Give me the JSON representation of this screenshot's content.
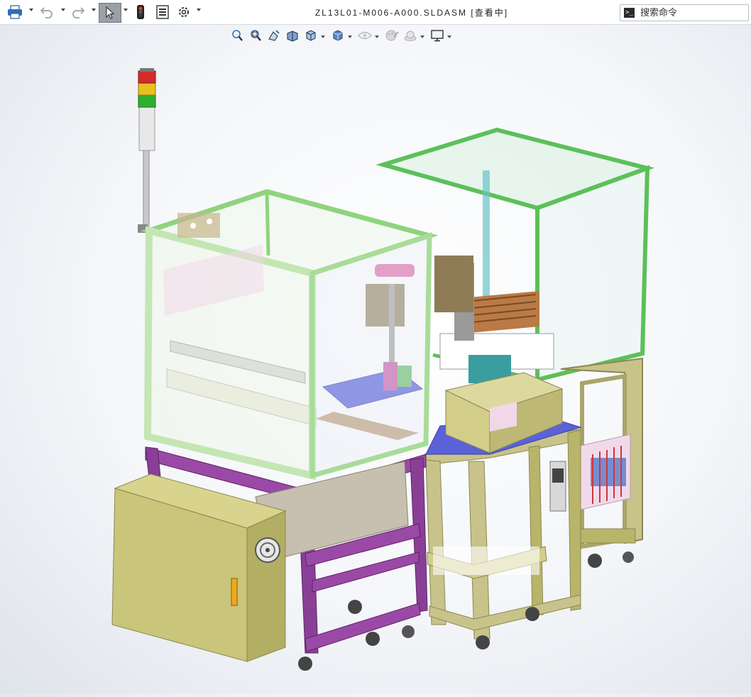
{
  "window": {
    "title": "ZL13L01-M006-A000.SLDASM [查看中]"
  },
  "toolbar": {
    "items": [
      {
        "name": "print",
        "icon": "printer-icon"
      },
      {
        "name": "undo",
        "icon": "undo-icon"
      },
      {
        "name": "redo",
        "icon": "redo-icon"
      },
      {
        "name": "select",
        "icon": "cursor-icon"
      },
      {
        "name": "traffic-light",
        "icon": "traffic-light-icon"
      },
      {
        "name": "file-properties",
        "icon": "file-properties-icon"
      },
      {
        "name": "options",
        "icon": "gear-icon"
      }
    ]
  },
  "search": {
    "placeholder": "搜索命令"
  },
  "heads_up_toolbar": {
    "items": [
      "zoom-to-fit-icon",
      "zoom-to-area-icon",
      "previous-view-icon",
      "section-view-icon",
      "view-orientation-icon",
      "display-style-icon",
      "hide-show-icon",
      "edit-appearance-icon",
      "apply-scene-icon",
      "view-settings-icon"
    ]
  },
  "colors": {
    "frame_green": "#7cd26a",
    "frame_purple": "#8a3f96",
    "cabinet_olive": "#b8b46a",
    "plate_blue": "#5b62d8",
    "light_red": "#d52b2b",
    "light_yellow": "#e6c21f",
    "light_green": "#2fae2f"
  }
}
